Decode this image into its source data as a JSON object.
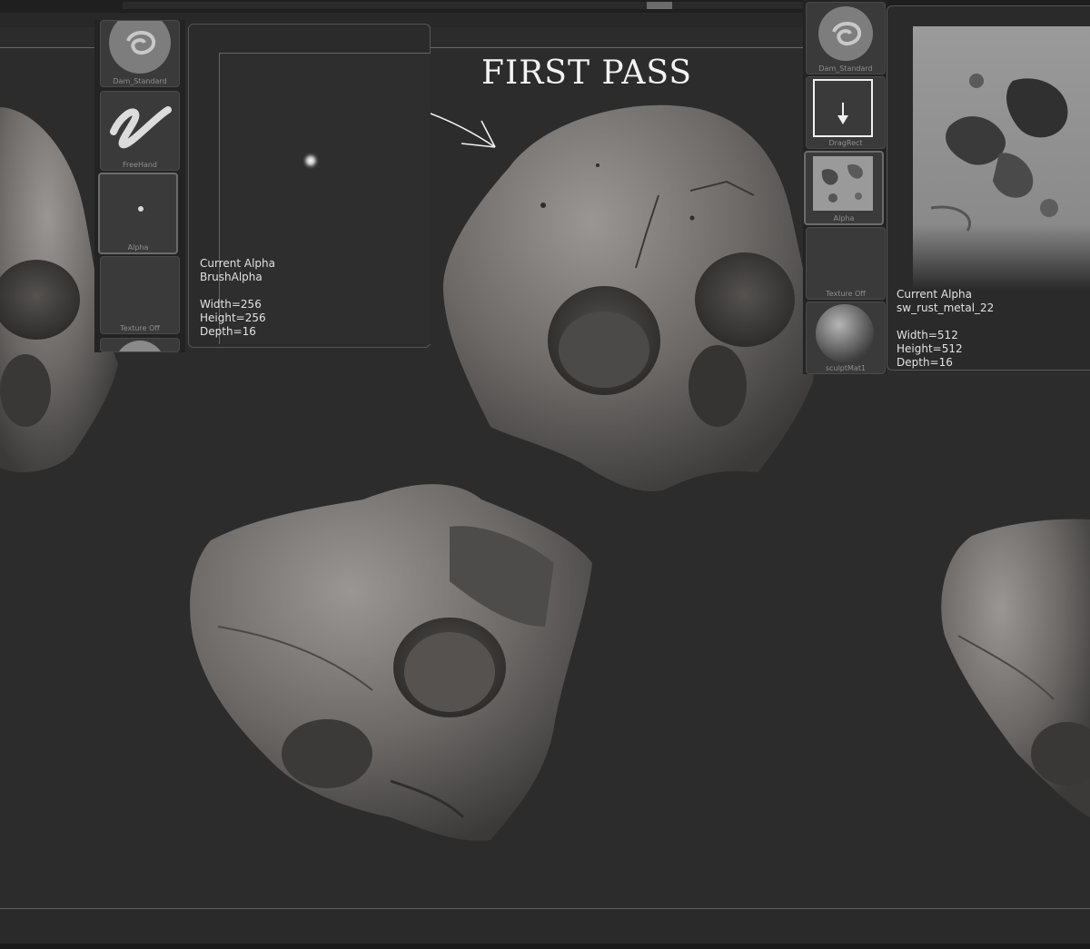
{
  "annotation": {
    "title": "FIRST PASS"
  },
  "left_palette": {
    "slots": [
      {
        "label": "Dam_Standard",
        "icon": "dam-standard-brush-icon"
      },
      {
        "label": "FreeHand",
        "icon": "freehand-stroke-icon"
      },
      {
        "label": "Alpha",
        "icon": "alpha-dot-icon"
      },
      {
        "label": "Texture Off",
        "icon": "texture-off-icon"
      },
      {
        "label": "",
        "icon": "material-sphere-icon"
      }
    ]
  },
  "left_alpha_popup": {
    "heading": "Current Alpha",
    "name": "BrushAlpha",
    "width": "Width=256",
    "height": "Height=256",
    "depth": "Depth=16"
  },
  "right_palette": {
    "slots": [
      {
        "label": "Dam_Standard",
        "icon": "dam-standard-brush-icon"
      },
      {
        "label": "DragRect",
        "icon": "dragrect-stroke-icon"
      },
      {
        "label": "Alpha",
        "icon": "rust-alpha-thumbnail-icon"
      },
      {
        "label": "Texture Off",
        "icon": "texture-off-icon"
      },
      {
        "label": "sculptMat1",
        "icon": "material-sphere-icon"
      }
    ]
  },
  "right_alpha_popup": {
    "heading": "Current Alpha",
    "name": "sw_rust_metal_22",
    "width": "Width=512",
    "height": "Height=512",
    "depth": "Depth=16"
  },
  "colors": {
    "background": "#2c2c2c",
    "skull": "#6e6b69",
    "panel": "#232323"
  }
}
